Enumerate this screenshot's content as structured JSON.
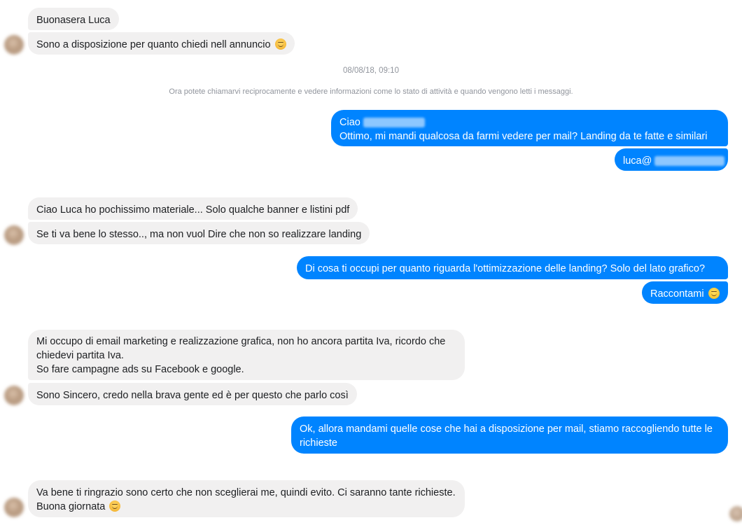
{
  "conversation": {
    "timestamp": "08/08/18, 09:10",
    "notice": "Ora potete chiamarvi reciprocamente e vedere informazioni come lo stato di attività e quando vengono letti i messaggi.",
    "messages": [
      {
        "sender": "other",
        "text": "Buonasera Luca"
      },
      {
        "sender": "other",
        "text": "Sono a disposizione per quanto chiedi nell annuncio",
        "emoji": "relieved-face"
      },
      {
        "sender": "me",
        "text": "Ciao"
      },
      {
        "sender": "me",
        "text": "Ottimo, mi mandi qualcosa da farmi vedere per mail? Landing da te fatte e similari"
      },
      {
        "sender": "me",
        "text": "luca@"
      },
      {
        "sender": "other",
        "text": "Ciao Luca ho pochissimo materiale... Solo qualche banner e listini pdf"
      },
      {
        "sender": "other",
        "text": "Se ti va bene lo stesso.., ma non vuol Dire che non so realizzare landing"
      },
      {
        "sender": "me",
        "text": "Di cosa ti occupi per quanto riguarda l'ottimizzazione delle landing? Solo del lato grafico?"
      },
      {
        "sender": "me",
        "text": "Raccontami",
        "emoji": "smiling-face"
      },
      {
        "sender": "other",
        "text": "Mi occupo di email marketing e realizzazione grafica, non ho ancora partita Iva, ricordo che chiedevi partita Iva."
      },
      {
        "sender": "other",
        "text": "So fare campagne ads su Facebook e google."
      },
      {
        "sender": "other",
        "text": "Sono Sincero, credo nella brava gente ed è per questo che parlo così"
      },
      {
        "sender": "me",
        "text": "Ok, allora mandami quelle cose che hai a disposizione per mail, stiamo raccogliendo tutte le richieste"
      },
      {
        "sender": "other",
        "text": "Va bene ti ringrazio sono certo che non sceglierai me, quindi evito. Ci saranno tante richieste. Buona giornata",
        "emoji": "smiling-eyes-face"
      }
    ]
  },
  "colors": {
    "incoming_bubble": "#f1f0f0",
    "outgoing_bubble": "#0084ff",
    "meta_text": "#90949c"
  }
}
